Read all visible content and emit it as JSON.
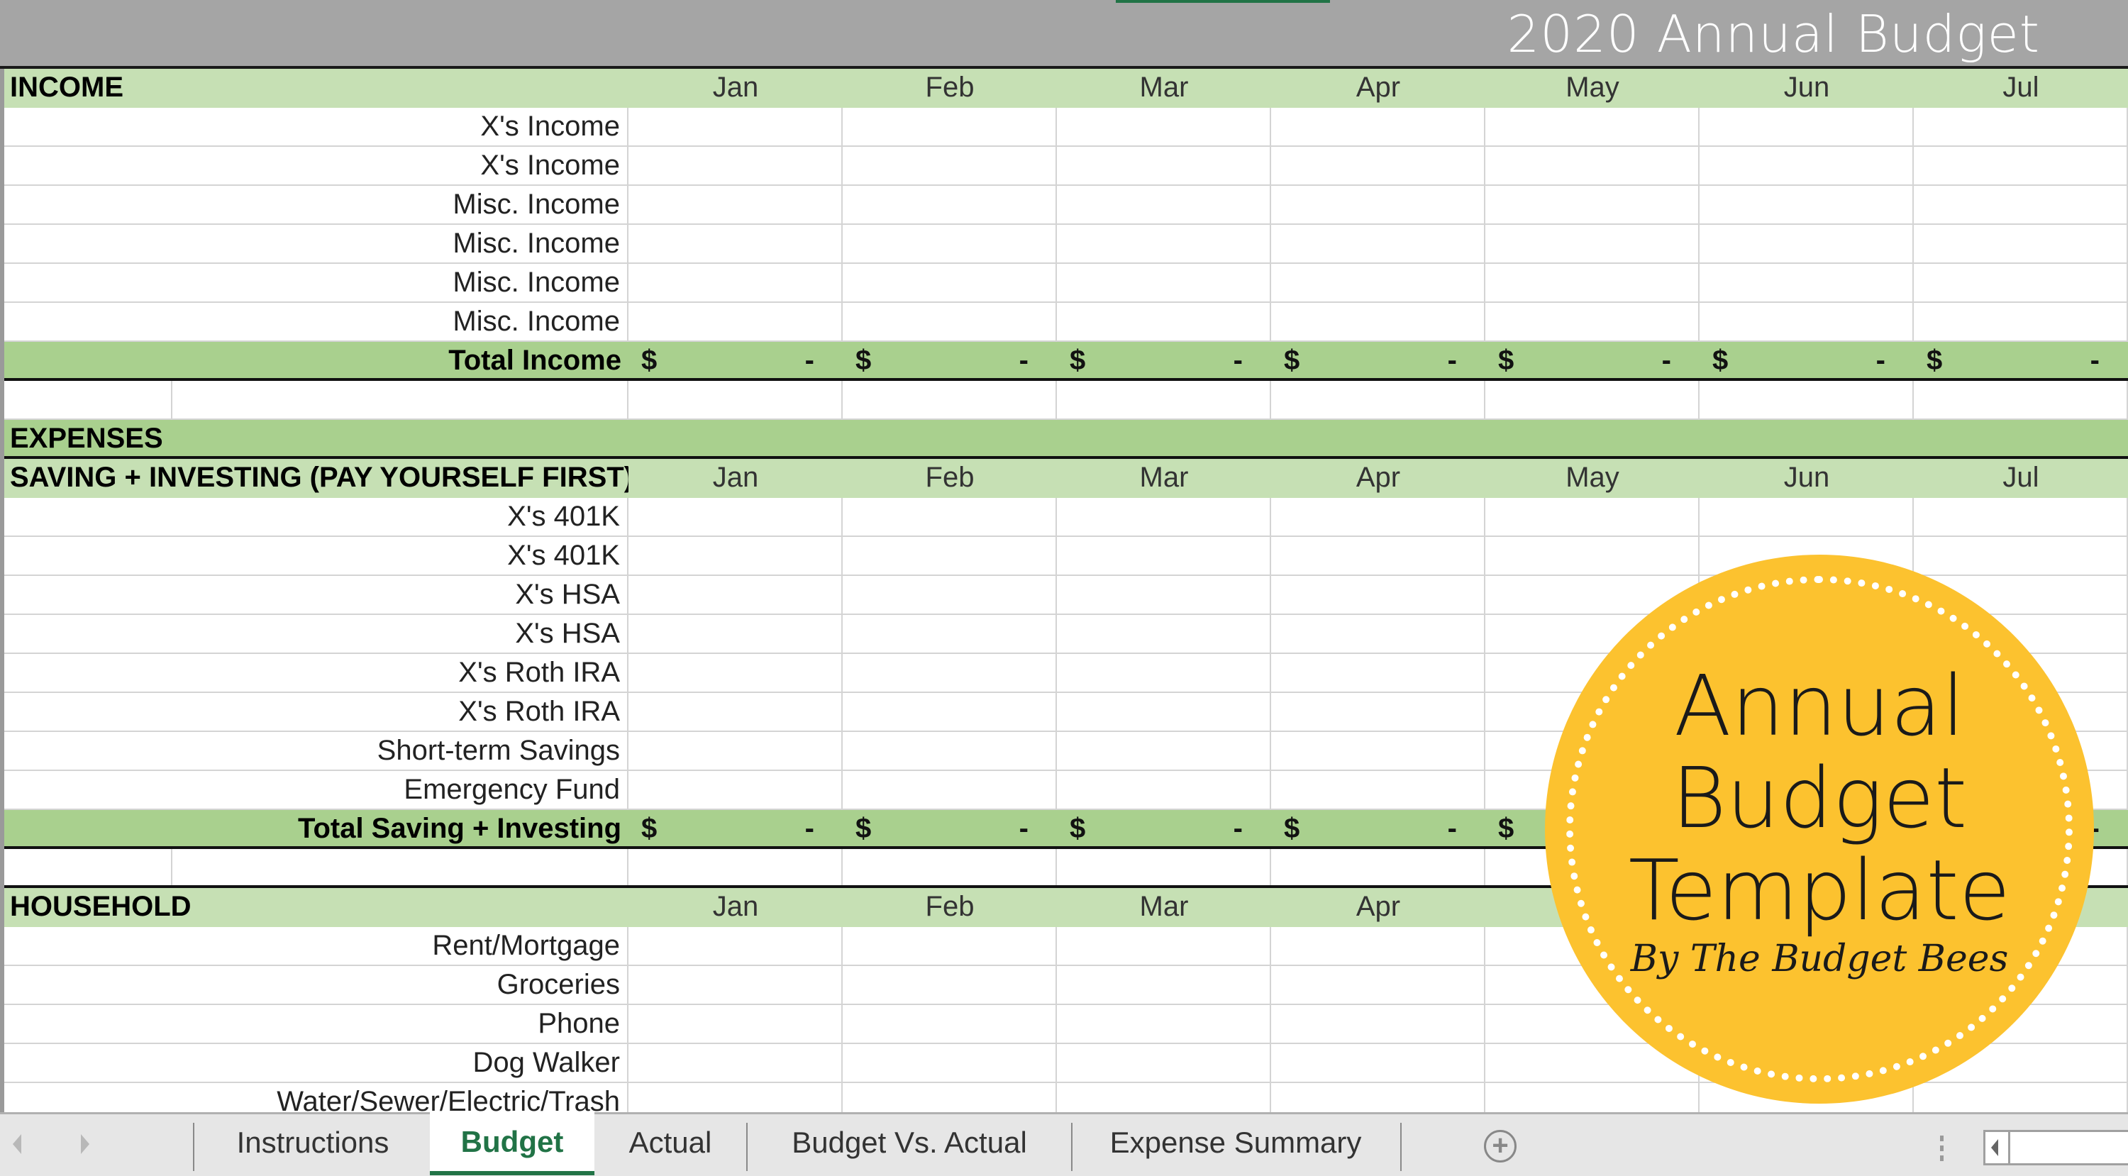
{
  "sheet_title": "2020 Annual Budget",
  "months": [
    "Jan",
    "Feb",
    "Mar",
    "Apr",
    "May",
    "Jun",
    "Jul"
  ],
  "sections": {
    "income": {
      "header": "INCOME",
      "rows": [
        "X's Income",
        "X's Income",
        "Misc. Income",
        "Misc. Income",
        "Misc. Income",
        "Misc. Income"
      ],
      "total_label": "Total Income",
      "total_values": [
        "-",
        "-",
        "-",
        "-",
        "-",
        "-",
        "-"
      ]
    },
    "expenses_band": "EXPENSES",
    "saving": {
      "header": "SAVING + INVESTING (PAY YOURSELF FIRST)",
      "rows": [
        "X's 401K",
        "X's 401K",
        "X's HSA",
        "X's HSA",
        "X's Roth IRA",
        "X's Roth IRA",
        "Short-term Savings",
        "Emergency Fund"
      ],
      "total_label": "Total Saving + Investing",
      "total_values": [
        "-",
        "-",
        "-",
        "-",
        "-",
        "-",
        "-"
      ]
    },
    "household": {
      "header": "HOUSEHOLD",
      "rows": [
        "Rent/Mortgage",
        "Groceries",
        "Phone",
        "Dog Walker",
        "Water/Sewer/Electric/Trash"
      ]
    }
  },
  "currency_symbol": "$",
  "badge": {
    "line1": "Annual",
    "line2": "Budget",
    "line3": "Template",
    "byline": "By The Budget Bees",
    "color": "#fcc22f"
  },
  "tabs": [
    {
      "label": "Instructions",
      "active": false
    },
    {
      "label": "Budget",
      "active": true
    },
    {
      "label": "Actual",
      "active": false
    },
    {
      "label": "Budget Vs. Actual",
      "active": false
    },
    {
      "label": "Expense Summary",
      "active": false
    }
  ],
  "add_sheet_symbol": "+",
  "colors": {
    "header_green": "#c6e0b4",
    "total_green": "#a9d08e",
    "title_gray": "#a5a5a5",
    "active_tab": "#217346"
  }
}
